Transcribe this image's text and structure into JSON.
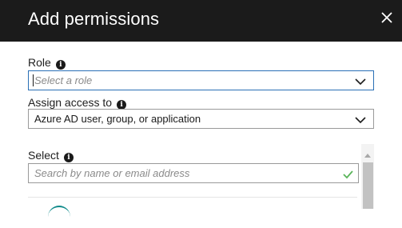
{
  "header": {
    "title": "Add permissions"
  },
  "role": {
    "label": "Role",
    "placeholder": "Select a role"
  },
  "assign": {
    "label": "Assign access to",
    "value": "Azure AD user, group, or application"
  },
  "select": {
    "label": "Select",
    "placeholder": "Search by name or email address"
  },
  "icons": {
    "close": "close-icon",
    "info": "info-icon",
    "chevron": "chevron-down-icon",
    "check": "checkmark-icon"
  },
  "colors": {
    "header_bg": "#1b1b1b",
    "focus_border": "#2a6fb6",
    "check_green": "#5bb55b"
  }
}
